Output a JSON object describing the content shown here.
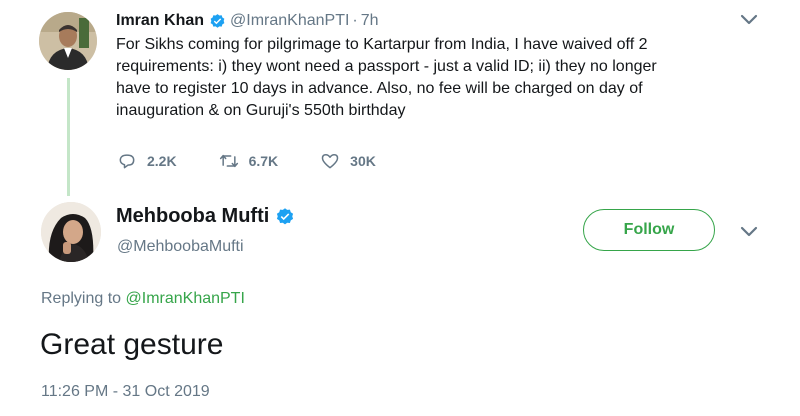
{
  "parent_tweet": {
    "author_name": "Imran Khan",
    "handle": "@ImranKhanPTI",
    "separator": "·",
    "time": "7h",
    "text": "For Sikhs coming for pilgrimage to Kartarpur from India, I have waived off 2\nrequirements: i) they wont need a passport - just a valid ID;   ii) they no longer\nhave to register 10 days in advance. Also, no fee will be charged on day of\ninauguration & on Guruji's 550th  birthday",
    "replies": "2.2K",
    "retweets": "6.7K",
    "likes": "30K"
  },
  "main_tweet": {
    "author_name": "Mehbooba Mufti",
    "handle": "@MehboobaMufti",
    "follow_label": "Follow",
    "replying_prefix": "Replying to",
    "replying_to": "@ImranKhanPTI",
    "text": "Great gesture",
    "timestamp": "11:26 PM - 31 Oct 2019"
  },
  "colors": {
    "accent": "#36a54a",
    "verified": "#1da1f2",
    "muted": "#657786",
    "text": "#14171a"
  },
  "icons": {
    "reply": "reply-icon",
    "retweet": "retweet-icon",
    "like": "heart-icon",
    "more": "chevron-down-icon",
    "verified": "verified-badge-icon"
  }
}
